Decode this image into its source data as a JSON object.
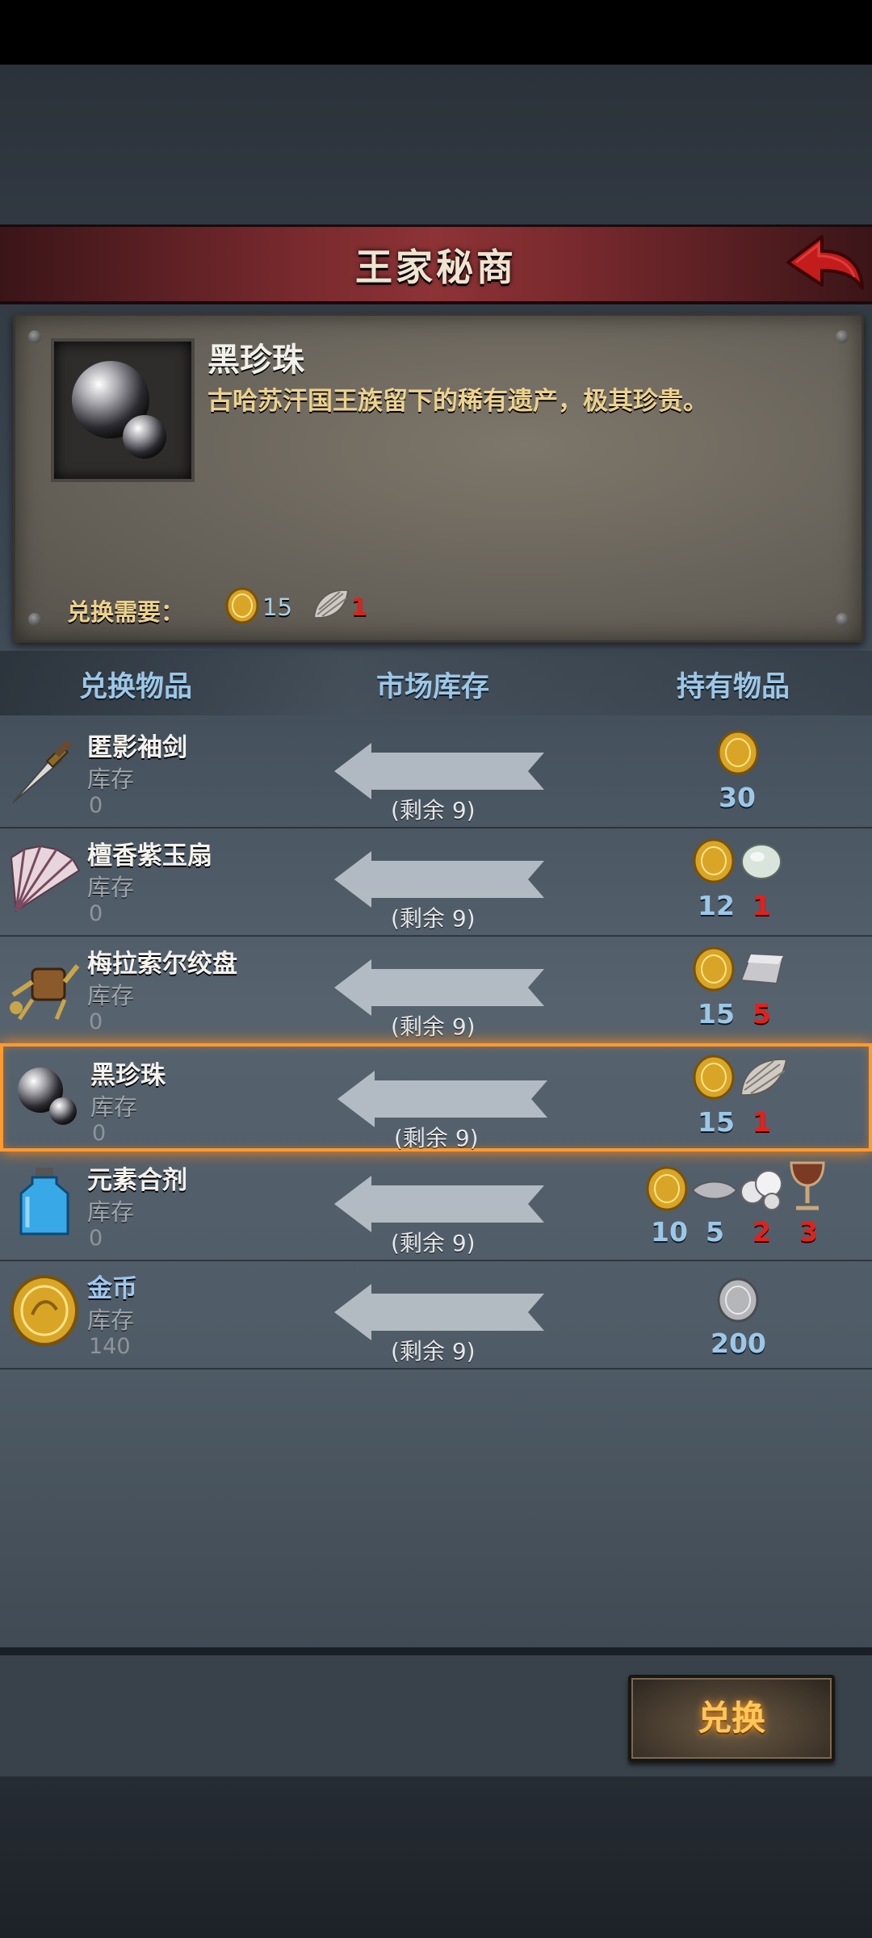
{
  "header": {
    "title": "王家秘商"
  },
  "detail": {
    "name": "黑珍珠",
    "description": "古哈苏汗国王族留下的稀有遗产，极其珍贵。",
    "requirement_label": "兑换需要：",
    "requirements": [
      {
        "icon": "gold-coin-icon",
        "value": "15"
      },
      {
        "icon": "shell-icon",
        "value": "1"
      }
    ]
  },
  "columns": {
    "item": "兑换物品",
    "stock": "市场库存",
    "owned": "持有物品"
  },
  "rows": [
    {
      "name": "匿影袖剑",
      "stock_label": "库存",
      "stock": "0",
      "remain": "(剩余 9)",
      "costs": [
        "30"
      ]
    },
    {
      "name": "檀香紫玉扇",
      "stock_label": "库存",
      "stock": "0",
      "remain": "(剩余 9)",
      "costs": [
        "12",
        "1"
      ]
    },
    {
      "name": "梅拉索尔绞盘",
      "stock_label": "库存",
      "stock": "0",
      "remain": "(剩余 9)",
      "costs": [
        "15",
        "5"
      ]
    },
    {
      "name": "黑珍珠",
      "stock_label": "库存",
      "stock": "0",
      "remain": "(剩余 9)",
      "costs": [
        "15",
        "1"
      ],
      "selected": true
    },
    {
      "name": "元素合剂",
      "stock_label": "库存",
      "stock": "0",
      "remain": "(剩余 9)",
      "costs": [
        "10",
        "5",
        "2",
        "3"
      ]
    },
    {
      "name": "金币",
      "stock_label": "库存",
      "stock": "140",
      "remain": "(剩余 9)",
      "costs": [
        "200"
      ]
    }
  ],
  "exchange_button": "兑换",
  "colors": {
    "accent": "#ff9a2e",
    "header": "#8d3336",
    "highlight_text": "#ecd28c",
    "insufficient": "#e3211c"
  }
}
